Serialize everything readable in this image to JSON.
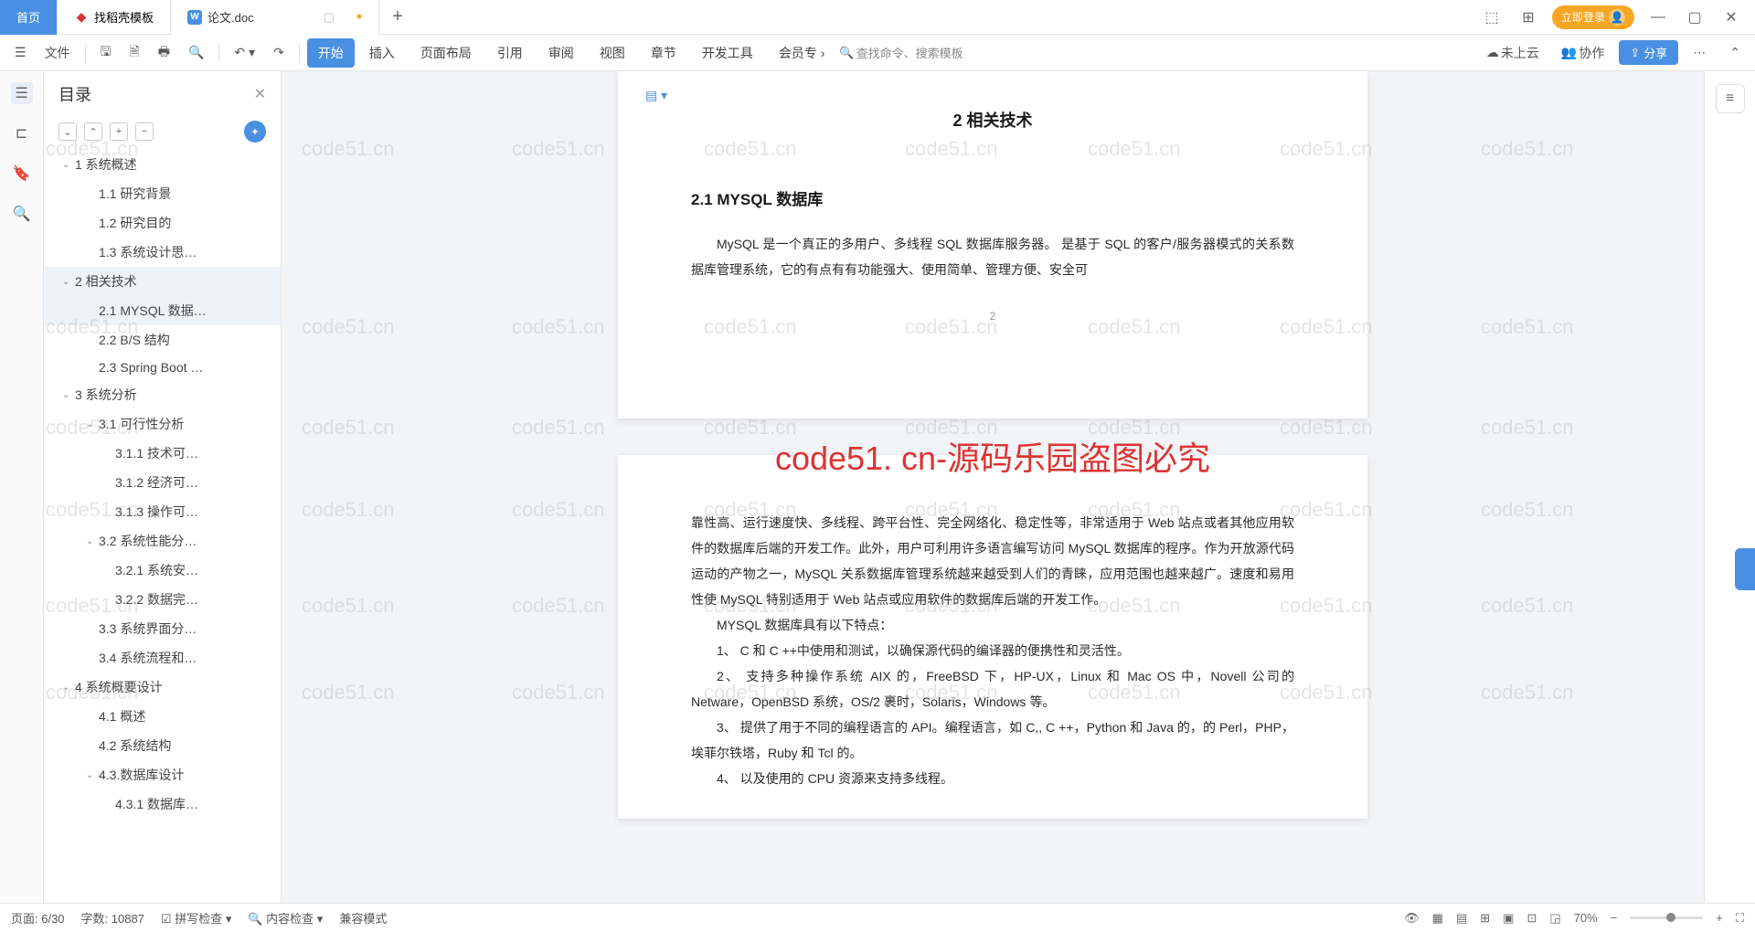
{
  "tabs": {
    "home": "首页",
    "t1": "找稻壳模板",
    "t2": "论文.doc",
    "add": "+"
  },
  "titlebar": {
    "login": "立即登录"
  },
  "toolbar": {
    "file": "文件",
    "menu": {
      "start": "开始",
      "insert": "插入",
      "layout": "页面布局",
      "ref": "引用",
      "review": "审阅",
      "view": "视图",
      "chapter": "章节",
      "dev": "开发工具",
      "member": "会员专"
    },
    "search_cmd": "查找命令、搜索模板",
    "cloud": "未上云",
    "collab": "协作",
    "share": "分享"
  },
  "outline": {
    "title": "目录",
    "items": [
      {
        "t": "1 系统概述",
        "lv": 1,
        "caret": true
      },
      {
        "t": "1.1 研究背景",
        "lv": 2
      },
      {
        "t": "1.2 研究目的",
        "lv": 2
      },
      {
        "t": "1.3 系统设计思…",
        "lv": 2
      },
      {
        "t": "2 相关技术",
        "lv": 1,
        "caret": true,
        "sel": true
      },
      {
        "t": "2.1 MYSQL 数据…",
        "lv": 2,
        "sel": true
      },
      {
        "t": "2.2 B/S 结构",
        "lv": 2
      },
      {
        "t": "2.3 Spring Boot …",
        "lv": 2
      },
      {
        "t": "3 系统分析",
        "lv": 1,
        "caret": true
      },
      {
        "t": "3.1 可行性分析",
        "lv": 2,
        "caret": true
      },
      {
        "t": "3.1.1 技术可…",
        "lv": 3
      },
      {
        "t": "3.1.2 经济可…",
        "lv": 3
      },
      {
        "t": "3.1.3 操作可…",
        "lv": 3
      },
      {
        "t": "3.2 系统性能分…",
        "lv": 2,
        "caret": true
      },
      {
        "t": "3.2.1  系统安…",
        "lv": 3
      },
      {
        "t": "3.2.2  数据完…",
        "lv": 3
      },
      {
        "t": "3.3 系统界面分…",
        "lv": 2
      },
      {
        "t": "3.4 系统流程和…",
        "lv": 2
      },
      {
        "t": "4 系统概要设计",
        "lv": 1,
        "caret": true
      },
      {
        "t": "4.1 概述",
        "lv": 2
      },
      {
        "t": "4.2 系统结构",
        "lv": 2
      },
      {
        "t": "4.3.数据库设计",
        "lv": 2,
        "caret": true
      },
      {
        "t": "4.3.1 数据库…",
        "lv": 3
      }
    ]
  },
  "doc": {
    "title": "2 相关技术",
    "h2": "2.1 MYSQL 数据库",
    "p1": "MySQL 是一个真正的多用户、多线程 SQL 数据库服务器。 是基于 SQL 的客户/服务器模式的关系数据库管理系统，它的有点有有功能强大、使用简单、管理方便、安全可",
    "pagenum": "2",
    "p2": "靠性高、运行速度快、多线程、跨平台性、完全网络化、稳定性等，非常适用于 Web 站点或者其他应用软件的数据库后端的开发工作。此外，用户可利用许多语言编写访问 MySQL 数据库的程序。作为开放源代码运动的产物之一，MySQL 关系数据库管理系统越来越受到人们的青睐，应用范围也越来越广。速度和易用性使 MySQL 特别适用于 Web 站点或应用软件的数据库后端的开发工作。",
    "p3": "MYSQL 数据库具有以下特点：",
    "p4": "1、 C 和 C ++中使用和测试，以确保源代码的编译器的便携性和灵活性。",
    "p5": "2、 支持多种操作系统 AIX 的，FreeBSD 下，HP-UX，Linux 和 Mac OS 中，Novell 公司的 Netware，OpenBSD 系统，OS/2 裹时，Solaris，Windows 等。",
    "p6": "3、 提供了用于不同的编程语言的 API。编程语言，如 C,, C ++，Python 和 Java 的，的 Perl，PHP，埃菲尔铁塔，Ruby 和 Tcl 的。",
    "p7": "4、 以及使用的 CPU 资源来支持多线程。"
  },
  "watermark": {
    "big": "code51. cn-源码乐园盗图必究",
    "small": "code51.cn"
  },
  "status": {
    "page": "页面: 6/30",
    "words": "字数: 10887",
    "spell": "拼写检查",
    "content": "内容检查",
    "compat": "兼容模式",
    "zoom": "70%"
  }
}
